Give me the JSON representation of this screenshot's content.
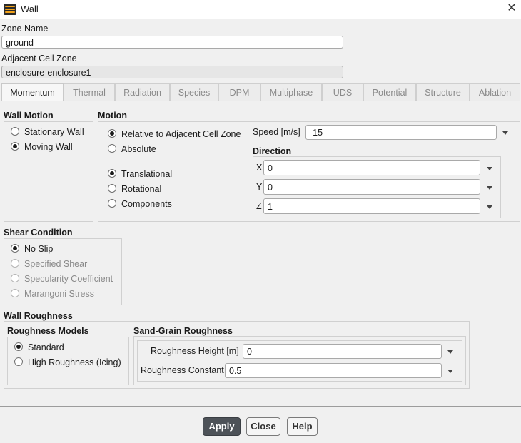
{
  "window": {
    "title": "Wall",
    "icon": "fluent-app-icon"
  },
  "zone_name": {
    "label": "Zone Name",
    "value": "ground"
  },
  "adjacent_cell_zone": {
    "label": "Adjacent Cell Zone",
    "value": "enclosure-enclosure1"
  },
  "tabs": [
    {
      "label": "Momentum",
      "active": true
    },
    {
      "label": "Thermal"
    },
    {
      "label": "Radiation"
    },
    {
      "label": "Species"
    },
    {
      "label": "DPM"
    },
    {
      "label": "Multiphase"
    },
    {
      "label": "UDS"
    },
    {
      "label": "Potential"
    },
    {
      "label": "Structure"
    },
    {
      "label": "Ablation"
    }
  ],
  "wall_motion": {
    "title": "Wall Motion",
    "options": [
      {
        "label": "Stationary Wall",
        "selected": false
      },
      {
        "label": "Moving Wall",
        "selected": true
      }
    ]
  },
  "motion": {
    "title": "Motion",
    "reference": [
      {
        "label": "Relative to Adjacent Cell Zone",
        "selected": true
      },
      {
        "label": "Absolute",
        "selected": false
      }
    ],
    "type": [
      {
        "label": "Translational",
        "selected": true
      },
      {
        "label": "Rotational",
        "selected": false
      },
      {
        "label": "Components",
        "selected": false
      }
    ],
    "speed": {
      "label": "Speed [m/s]",
      "value": "-15"
    },
    "direction": {
      "title": "Direction",
      "x": {
        "label": "X",
        "value": "0"
      },
      "y": {
        "label": "Y",
        "value": "0"
      },
      "z": {
        "label": "Z",
        "value": "1"
      }
    }
  },
  "shear_condition": {
    "title": "Shear Condition",
    "options": [
      {
        "label": "No Slip",
        "selected": true,
        "enabled": true
      },
      {
        "label": "Specified Shear",
        "selected": false,
        "enabled": false
      },
      {
        "label": "Specularity Coefficient",
        "selected": false,
        "enabled": false
      },
      {
        "label": "Marangoni Stress",
        "selected": false,
        "enabled": false
      }
    ]
  },
  "wall_roughness": {
    "title": "Wall Roughness",
    "models": {
      "title": "Roughness Models",
      "options": [
        {
          "label": "Standard",
          "selected": true
        },
        {
          "label": "High Roughness (Icing)",
          "selected": false
        }
      ]
    },
    "sand_grain": {
      "title": "Sand-Grain Roughness",
      "height": {
        "label": "Roughness Height [m]",
        "value": "0"
      },
      "constant": {
        "label": "Roughness Constant",
        "value": "0.5"
      }
    }
  },
  "buttons": {
    "apply": "Apply",
    "close": "Close",
    "help": "Help"
  }
}
